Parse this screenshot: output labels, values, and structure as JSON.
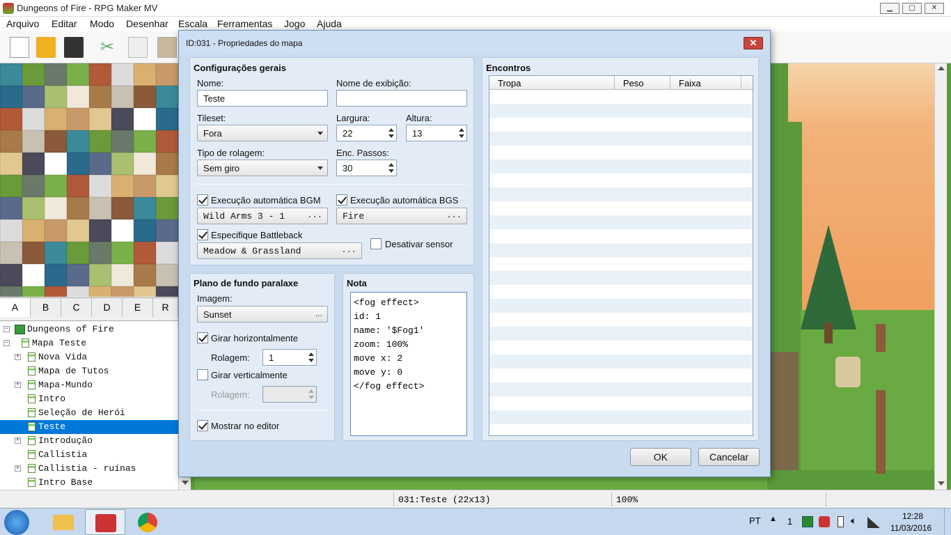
{
  "window": {
    "title": "Dungeons of Fire - RPG Maker MV"
  },
  "menu": [
    "Arquivo",
    "Editar",
    "Modo",
    "Desenhar",
    "Escala",
    "Ferramentas",
    "Jogo",
    "Ajuda"
  ],
  "tileset_tabs": [
    "A",
    "B",
    "C",
    "D",
    "E",
    "R"
  ],
  "tree": {
    "project": "Dungeons of Fire",
    "items": [
      {
        "label": "Mapa Teste",
        "level": 1,
        "expand": "−"
      },
      {
        "label": "Nova Vida",
        "level": 2,
        "expand": "+"
      },
      {
        "label": "Mapa de Tutos",
        "level": 2,
        "expand": ""
      },
      {
        "label": "Mapa-Mundo",
        "level": 2,
        "expand": "+"
      },
      {
        "label": "Intro",
        "level": 2,
        "expand": ""
      },
      {
        "label": "Seleção de Herói",
        "level": 2,
        "expand": ""
      },
      {
        "label": "Teste",
        "level": 2,
        "expand": "",
        "selected": true
      },
      {
        "label": "Introdução",
        "level": 2,
        "expand": "+"
      },
      {
        "label": "Callistia",
        "level": 2,
        "expand": ""
      },
      {
        "label": "Callistia - ruínas",
        "level": 2,
        "expand": "+"
      },
      {
        "label": "Intro Base",
        "level": 2,
        "expand": ""
      }
    ]
  },
  "status": {
    "map": "031:Teste (22x13)",
    "zoom": "100%"
  },
  "dialog": {
    "title": "ID:031 - Propriedades do mapa",
    "general": {
      "title": "Configurações gerais",
      "name_label": "Nome:",
      "name_value": "Teste",
      "display_label": "Nome de exibição:",
      "display_value": "",
      "tileset_label": "Tileset:",
      "tileset_value": "Fora",
      "width_label": "Largura:",
      "width_value": "22",
      "height_label": "Altura:",
      "height_value": "13",
      "scroll_label": "Tipo de rolagem:",
      "scroll_value": "Sem giro",
      "enc_label": "Enc. Passos:",
      "enc_value": "30",
      "bgm_label": "Execução automática BGM",
      "bgm_value": "Wild Arms 3 - 1",
      "bgs_label": "Execução automática BGS",
      "bgs_value": "Fire",
      "battleback_label": "Especifique Battleback",
      "battleback_value": "Meadow & Grassland",
      "disable_dash_label": "Desativar sensor"
    },
    "parallax": {
      "title": "Plano de fundo paralaxe",
      "image_label": "Imagem:",
      "image_value": "Sunset",
      "loop_h_label": "Girar horizontalmente",
      "scroll_label": "Rolagem:",
      "scroll_h_value": "1",
      "loop_v_label": "Girar verticalmente",
      "scroll_v_value": "",
      "show_editor_label": "Mostrar no editor"
    },
    "note": {
      "title": "Nota",
      "text": "<fog effect>\nid: 1\nname: '$Fog1'\nzoom: 100%\nmove x: 2\nmove y: 0\n</fog effect>"
    },
    "encounters": {
      "title": "Encontros",
      "columns": [
        "Tropa",
        "Peso",
        "Faixa"
      ]
    },
    "ok_label": "OK",
    "cancel_label": "Cancelar",
    "dots": "..."
  },
  "taskbar": {
    "lang": "PT",
    "notif_count": "1",
    "time": "12:28",
    "date": "11/03/2016"
  }
}
